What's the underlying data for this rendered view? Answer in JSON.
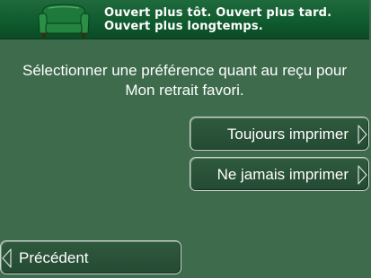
{
  "banner": {
    "line1": "Ouvert plus tôt.  Ouvert plus tard.",
    "line2": "Ouvert plus longtemps.",
    "logo_icon": "armchair-icon"
  },
  "prompt": {
    "line1": "Sélectionner une préférence quant au reçu pour",
    "line2": "Mon retrait favori."
  },
  "options": {
    "always_print": "Toujours imprimer",
    "never_print": "Ne jamais imprimer"
  },
  "nav": {
    "previous": "Précédent"
  },
  "colors": {
    "background": "#3d6b4c",
    "banner": "#0f5a2e",
    "button_border": "#c9d6cb",
    "text": "#ffffff"
  }
}
